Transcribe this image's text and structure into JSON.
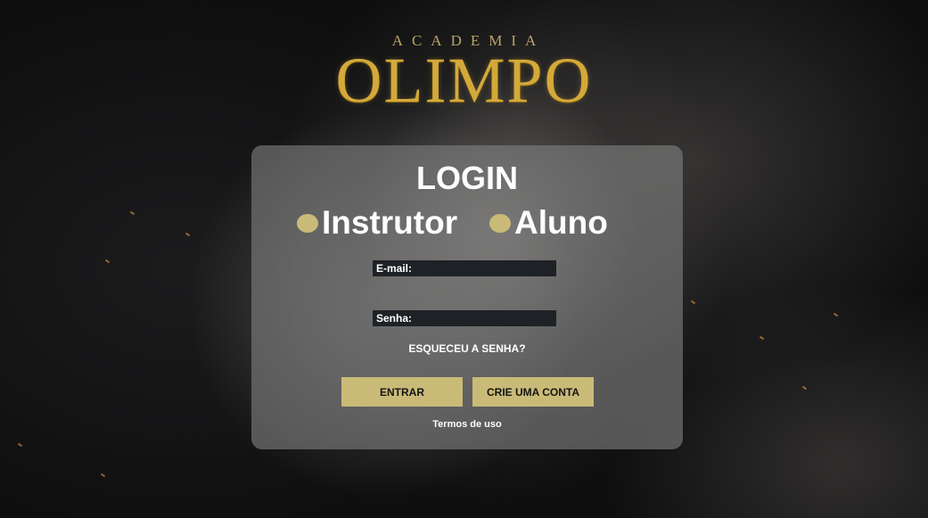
{
  "brand": {
    "top_line": "ACADEMIA",
    "name": "OLIMPO"
  },
  "login": {
    "title": "LOGIN",
    "roles": [
      {
        "label": "Instrutor"
      },
      {
        "label": "Aluno"
      }
    ],
    "email_label": "E-mail:",
    "email_value": "",
    "password_label": "Senha:",
    "password_value": "",
    "forgot_password": "ESQUECEU A SENHA?",
    "enter_button": "ENTRAR",
    "create_account_button": "CRIE UMA CONTA",
    "terms_link": "Termos de uso"
  },
  "colors": {
    "accent": "#c9bb77",
    "logo_gold": "#d4a93a",
    "card_background": "#808080",
    "field_background": "#1e2226"
  }
}
